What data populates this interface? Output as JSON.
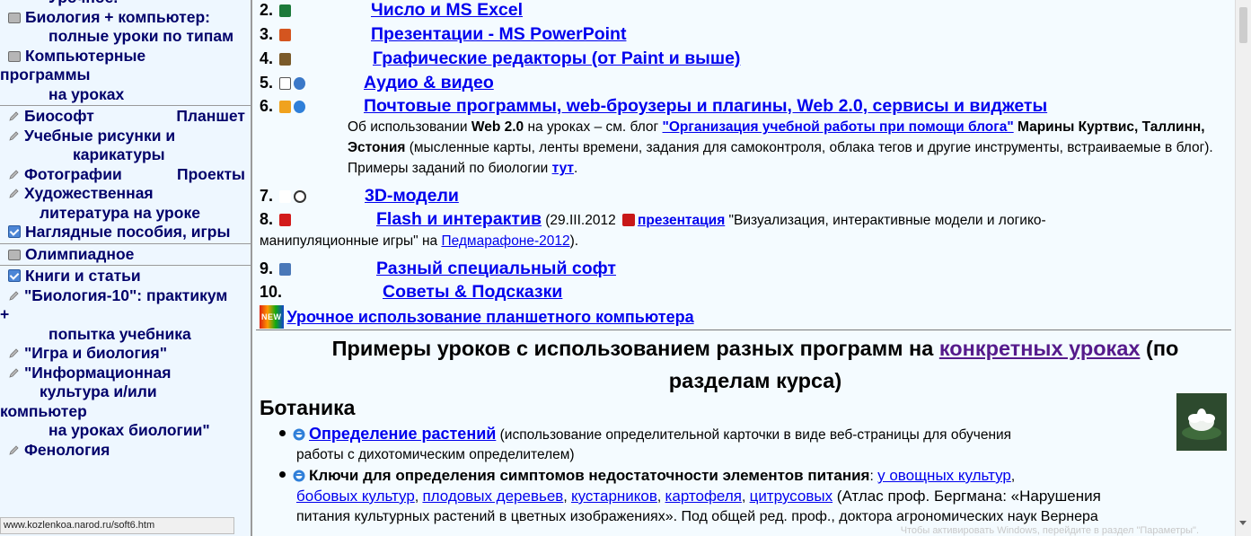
{
  "sidebar": {
    "items": [
      {
        "text": "Урочное."
      },
      {
        "text": "Биология + компьютер:"
      },
      {
        "text": "полные уроки по типам"
      },
      {
        "text": "Компьютерные"
      },
      {
        "text": "программы"
      },
      {
        "text": "на уроках"
      },
      {
        "text": "Биософт",
        "right": "Планшет"
      },
      {
        "text": "Учебные рисунки и"
      },
      {
        "text": "карикатуры"
      },
      {
        "text": "Фотографии",
        "right": "Проекты"
      },
      {
        "text": "Художественная"
      },
      {
        "text": "литература на уроке"
      },
      {
        "text": "Наглядные пособия, игры"
      },
      {
        "text": "Олимпиадное"
      },
      {
        "text": "Книги и статьи"
      },
      {
        "text": "\"Биология-10\": практикум"
      },
      {
        "text": "+"
      },
      {
        "text": "попытка учебника"
      },
      {
        "text": "\"Игра и биология\""
      },
      {
        "text": "\"Информационная"
      },
      {
        "text": "культура и/или"
      },
      {
        "text": "компьютер"
      },
      {
        "text": "на уроках биологии\""
      },
      {
        "text": "Фенология"
      }
    ]
  },
  "status_bar": {
    "url": "www.kozlenkoa.narod.ru/soft6.htm"
  },
  "list": [
    {
      "num": "2.",
      "label": "Число и MS Excel"
    },
    {
      "num": "3.",
      "label": "Презентации - MS PowerPoint"
    },
    {
      "num": "4.",
      "label": "Графические редакторы (от Paint и выше)"
    },
    {
      "num": "5.",
      "label": "Аудио & видео"
    },
    {
      "num": "6.",
      "label": "Почтовые программы, web-броузеры и плагины, Web 2.0, сервисы и виджеты"
    },
    {
      "num": "7.",
      "label": "3D-модели"
    },
    {
      "num": "8.",
      "label": "Flash и интерактив"
    },
    {
      "num": "9.",
      "label": "Разный специальный софт"
    },
    {
      "num": "10.",
      "label": "Советы & Подсказки"
    }
  ],
  "web20_note": {
    "t1": "Об использовании ",
    "b1": "Web 2.0",
    "t2": " на уроках – см. блог ",
    "link": "\"Организация учебной работы при помощи блога\"",
    "b2": " Марины Куртвис, Таллинн, Эстония",
    "t3": " (мысленные карты, ленты времени, задания для самоконтроля, облака тегов и другие инструменты, встраиваемые в блог). Примеры заданий по биологии ",
    "here": "тут",
    "end": "."
  },
  "flash_note": {
    "date": " (29.III.2012 ",
    "pres": "презентация",
    "t1": " \"Визуализация, интерактивные модели и логико-",
    "t2": "манипуляционные игры\" на ",
    "link": "Педмарафоне-2012",
    "end": ")."
  },
  "new_item": {
    "badge": "NEW",
    "label": "Урочное использование планшетного компьютера"
  },
  "examples_heading": {
    "pre": "Примеры уроков с использованием разных программ на ",
    "link": "конкретных уроках",
    "post": " (по",
    "line2": "разделам курса)"
  },
  "botany": {
    "title": "Ботаника",
    "b1_link": "Определение растений",
    "b1_t1": " (использование определительной карточки в виде веб-страницы для обучения",
    "b1_t2": "работы с дихотомическим определителем)",
    "b2_bold": "Ключи для определения симптомов недостаточности элементов питания",
    "b2_colon": ": ",
    "links": [
      "у овощных культур",
      "бобовых культур",
      "плодовых деревьев",
      "кустарников",
      "картофеля",
      "цитрусовых"
    ],
    "b2_t1": " (Атлас проф. Бергмана: «Нарушения",
    "b2_t2": "питания культурных растений в цветных изображениях». Под общей ред. проф., доктора агрономических наук Вернера"
  },
  "watermark": "Чтобы активировать Windows, перейдите в раздел \"Параметры\"."
}
